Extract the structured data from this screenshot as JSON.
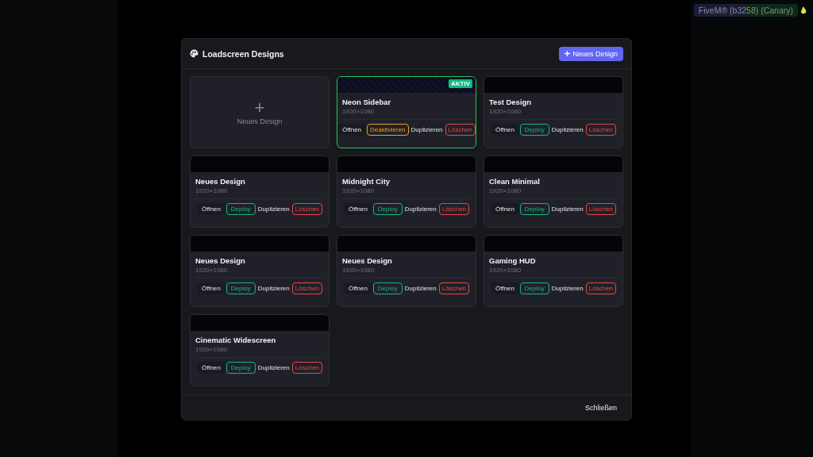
{
  "app_badge": {
    "title": "FiveM® (b3258) (Canary)"
  },
  "modal": {
    "title": "Loadscreen Designs",
    "new_button": "Neues Design",
    "close_button": "Schließen",
    "cards": [
      {
        "kind": "new",
        "label": "Neues Design",
        "icon": "+"
      },
      {
        "kind": "design",
        "name": "Neon Sidebar",
        "resolution": "1920×1080",
        "active": true,
        "badge": "AKTIV",
        "actions": [
          {
            "kind": "open",
            "label": "Öffnen"
          },
          {
            "kind": "deactivate",
            "label": "Deaktivieren"
          },
          {
            "kind": "duplicate",
            "label": "Duplizieren"
          },
          {
            "kind": "delete",
            "label": "Löschen"
          }
        ]
      },
      {
        "kind": "design",
        "name": "Test Design",
        "resolution": "1920×1080",
        "active": false,
        "actions": [
          {
            "kind": "open",
            "label": "Öffnen"
          },
          {
            "kind": "deploy",
            "label": "Deploy"
          },
          {
            "kind": "duplicate",
            "label": "Duplizieren"
          },
          {
            "kind": "delete",
            "label": "Löschen"
          }
        ]
      },
      {
        "kind": "design",
        "name": "Neues Design",
        "resolution": "1920×1080",
        "active": false,
        "actions": [
          {
            "kind": "open",
            "label": "Öffnen"
          },
          {
            "kind": "deploy",
            "label": "Deploy"
          },
          {
            "kind": "duplicate",
            "label": "Duplizieren"
          },
          {
            "kind": "delete",
            "label": "Löschen"
          }
        ]
      },
      {
        "kind": "design",
        "name": "Midnight City",
        "resolution": "1920×1080",
        "active": false,
        "actions": [
          {
            "kind": "open",
            "label": "Öffnen"
          },
          {
            "kind": "deploy",
            "label": "Deploy"
          },
          {
            "kind": "duplicate",
            "label": "Duplizieren"
          },
          {
            "kind": "delete",
            "label": "Löschen"
          }
        ]
      },
      {
        "kind": "design",
        "name": "Clean Minimal",
        "resolution": "1920×1080",
        "active": false,
        "actions": [
          {
            "kind": "open",
            "label": "Öffnen"
          },
          {
            "kind": "deploy",
            "label": "Deploy"
          },
          {
            "kind": "duplicate",
            "label": "Duplizieren"
          },
          {
            "kind": "delete",
            "label": "Löschen"
          }
        ]
      },
      {
        "kind": "design",
        "name": "Neues Design",
        "resolution": "1920×1080",
        "active": false,
        "actions": [
          {
            "kind": "open",
            "label": "Öffnen"
          },
          {
            "kind": "deploy",
            "label": "Deploy"
          },
          {
            "kind": "duplicate",
            "label": "Duplizieren"
          },
          {
            "kind": "delete",
            "label": "Löschen"
          }
        ]
      },
      {
        "kind": "design",
        "name": "Neues Design",
        "resolution": "1920×1080",
        "active": false,
        "actions": [
          {
            "kind": "open",
            "label": "Öffnen"
          },
          {
            "kind": "deploy",
            "label": "Deploy"
          },
          {
            "kind": "duplicate",
            "label": "Duplizieren"
          },
          {
            "kind": "delete",
            "label": "Löschen"
          }
        ]
      },
      {
        "kind": "design",
        "name": "Gaming HUD",
        "resolution": "1920×1080",
        "active": false,
        "actions": [
          {
            "kind": "open",
            "label": "Öffnen"
          },
          {
            "kind": "deploy",
            "label": "Deploy"
          },
          {
            "kind": "duplicate",
            "label": "Duplizieren"
          },
          {
            "kind": "delete",
            "label": "Löschen"
          }
        ]
      },
      {
        "kind": "design",
        "name": "Cinematic Widescreen",
        "resolution": "1920×1080",
        "active": false,
        "actions": [
          {
            "kind": "open",
            "label": "Öffnen"
          },
          {
            "kind": "deploy",
            "label": "Deploy"
          },
          {
            "kind": "duplicate",
            "label": "Duplizieren"
          },
          {
            "kind": "delete",
            "label": "Löschen"
          }
        ]
      }
    ]
  }
}
